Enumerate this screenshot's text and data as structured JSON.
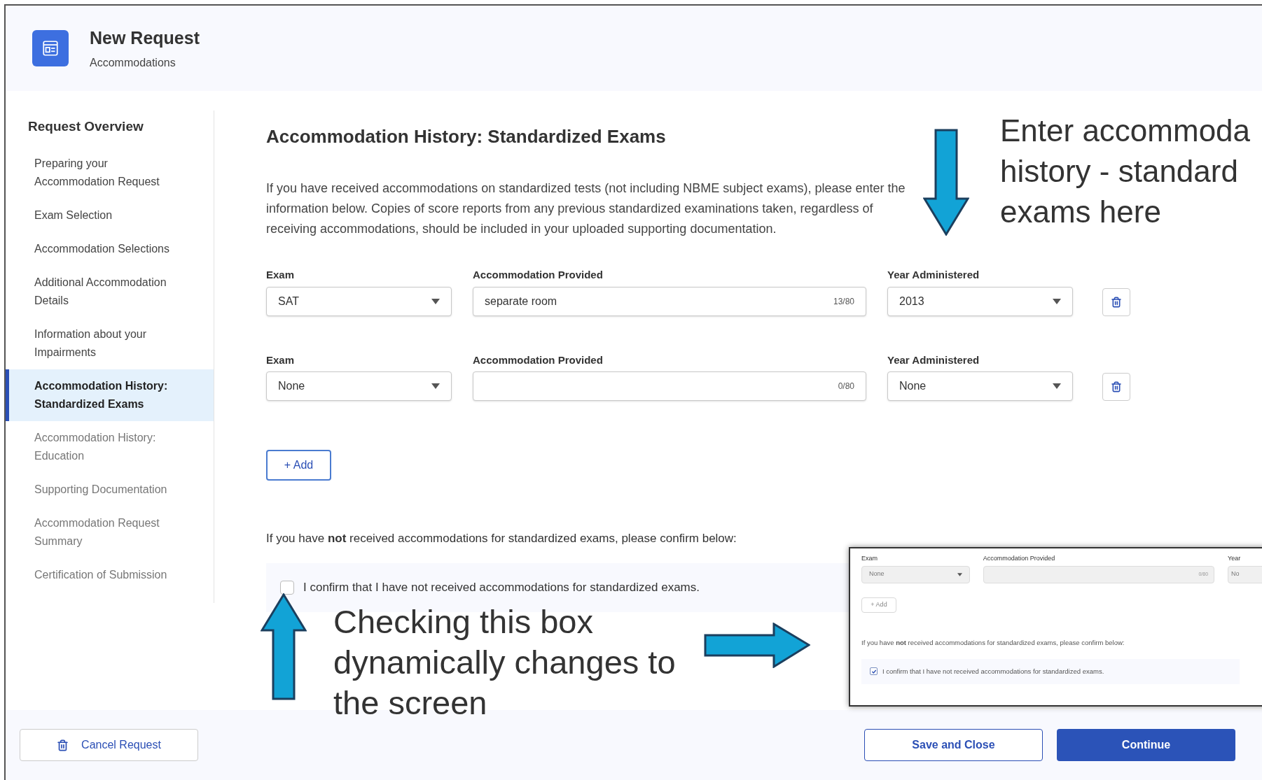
{
  "header": {
    "title": "New Request",
    "subtitle": "Accommodations"
  },
  "sidebar": {
    "heading": "Request Overview",
    "items": [
      {
        "label": "Preparing your Accommodation Request",
        "selected": false,
        "visited": true
      },
      {
        "label": "Exam Selection",
        "selected": false,
        "visited": true
      },
      {
        "label": "Accommodation Selections",
        "selected": false,
        "visited": true
      },
      {
        "label": "Additional Accommodation Details",
        "selected": false,
        "visited": true
      },
      {
        "label": "Information about your Impairments",
        "selected": false,
        "visited": true
      },
      {
        "label": "Accommodation History: Standardized Exams",
        "selected": true,
        "visited": true
      },
      {
        "label": "Accommodation History: Education",
        "selected": false,
        "visited": false
      },
      {
        "label": "Supporting Documentation",
        "selected": false,
        "visited": false
      },
      {
        "label": "Accommodation Request Summary",
        "selected": false,
        "visited": false
      },
      {
        "label": "Certification of Submission",
        "selected": false,
        "visited": false
      }
    ]
  },
  "main": {
    "title": "Accommodation History: Standardized Exams",
    "intro": "If you have received accommodations on standardized tests (not including NBME subject exams), please enter the information below. Copies of score reports from any previous standardized examinations taken, regardless of receiving accommodations, should be included in your uploaded supporting documentation.",
    "rows": [
      {
        "exam": {
          "label": "Exam",
          "value": "SAT"
        },
        "accommodation": {
          "label": "Accommodation Provided",
          "value": "separate room",
          "counter": "13/80"
        },
        "year": {
          "label": "Year Administered",
          "value": "2013"
        }
      },
      {
        "exam": {
          "label": "Exam",
          "value": "None"
        },
        "accommodation": {
          "label": "Accommodation Provided",
          "counter": "0/80"
        },
        "year": {
          "label": "Year Administered",
          "value": "None"
        }
      }
    ],
    "add_button": "+ Add",
    "confirm_prompt": "If you have **not** received accommodations for standardized exams, please confirm below:",
    "confirm": {
      "label": "I confirm that I have not received accommodations for standardized exams.",
      "checked": false
    }
  },
  "annotations": {
    "top_note": [
      "Enter accommoda",
      "history - standard",
      "exams here"
    ],
    "bottom_note": [
      "Checking this box",
      "dynamically changes to",
      "the screen"
    ]
  },
  "inset": {
    "exam": {
      "label": "Exam",
      "value": "None"
    },
    "accommodation": {
      "label": "Accommodation Provided",
      "counter": "0/80"
    },
    "year": {
      "label": "Year",
      "value": "No"
    },
    "add_button": "+ Add",
    "confirm_prompt": "If you have **not** received accommodations for standardized exams, please confirm below:",
    "confirm": {
      "label": "I confirm that I have not received accommodations for standardized exams.",
      "checked": true
    }
  },
  "footer": {
    "cancel": "Cancel Request",
    "save": "Save and Close",
    "continue": "Continue"
  }
}
